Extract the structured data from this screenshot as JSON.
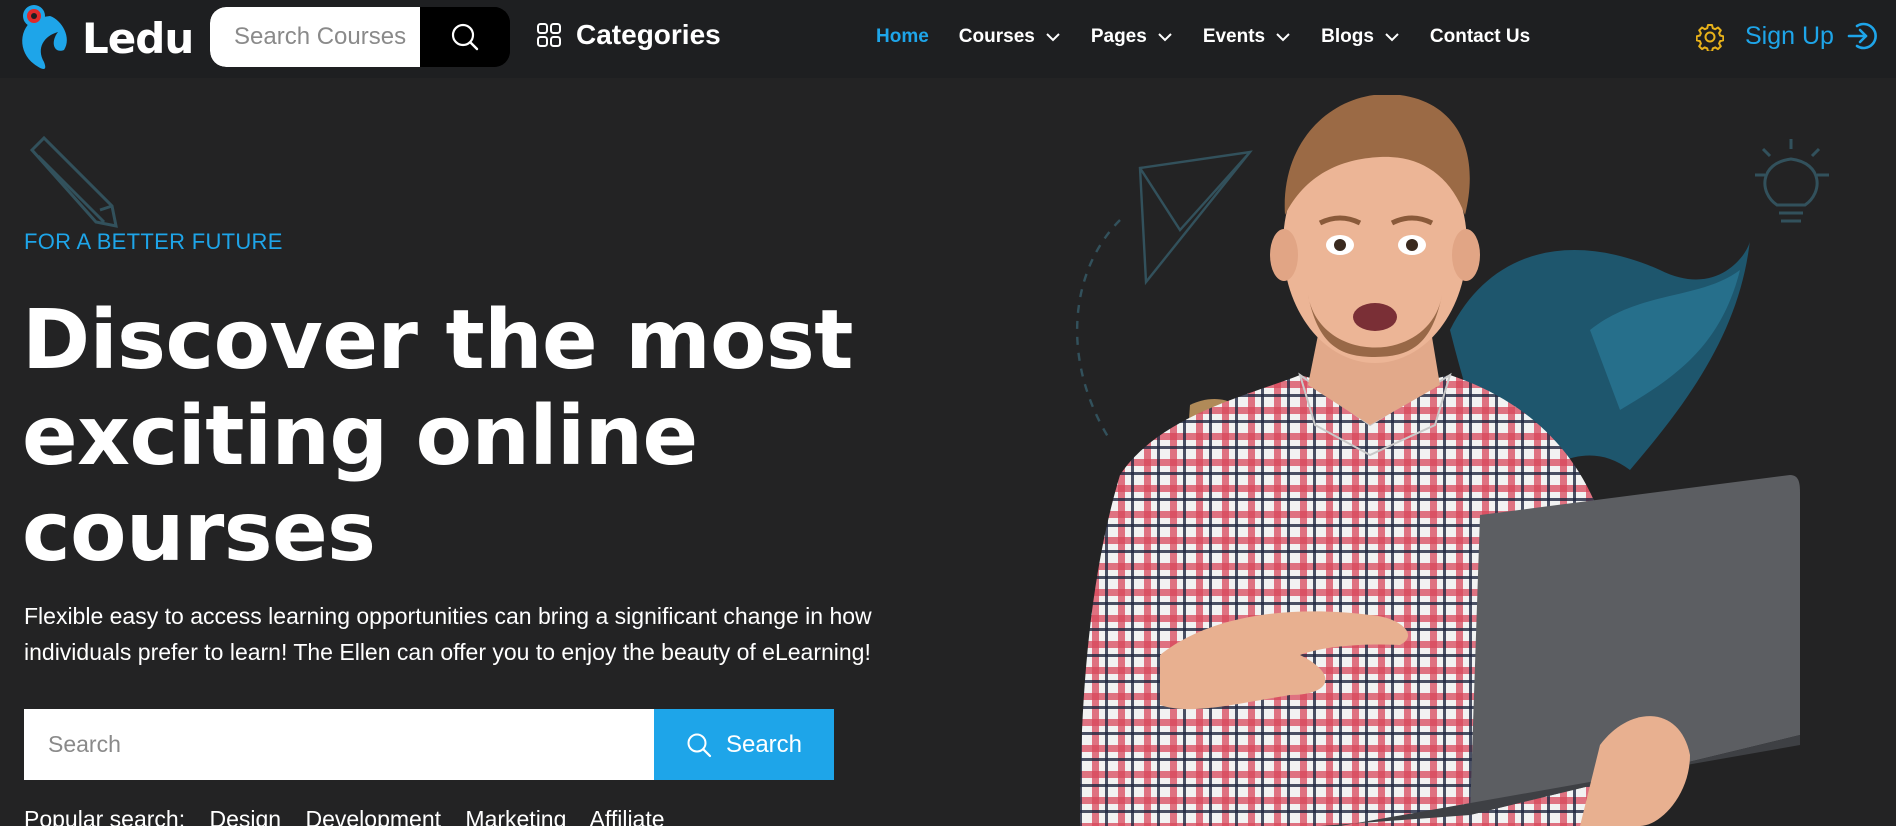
{
  "brand": {
    "name": "Ledu",
    "accent": "#1ea5e9"
  },
  "header": {
    "search_placeholder": "Search Courses",
    "categories_label": "Categories",
    "nav": [
      {
        "label": "Home",
        "active": true,
        "dropdown": false
      },
      {
        "label": "Courses",
        "active": false,
        "dropdown": true
      },
      {
        "label": "Pages",
        "active": false,
        "dropdown": true
      },
      {
        "label": "Events",
        "active": false,
        "dropdown": true
      },
      {
        "label": "Blogs",
        "active": false,
        "dropdown": true
      },
      {
        "label": "Contact Us",
        "active": false,
        "dropdown": false
      }
    ],
    "signup_label": "Sign Up",
    "icons": [
      "search-icon",
      "grid-icon",
      "chevron-down-icon",
      "gear-icon",
      "sign-in-icon"
    ]
  },
  "hero": {
    "eyebrow": "FOR A BETTER FUTURE",
    "headline": "Discover the most exciting online courses",
    "subtext": "Flexible easy to access learning opportunities can bring a significant change in how individuals prefer to learn! The Ellen can offer you to enjoy the beauty of eLearning!",
    "search_placeholder": "Search",
    "search_button": "Search",
    "popular_label": "Popular search:",
    "popular_tags": [
      "Design",
      "Development",
      "Marketing",
      "Affiliate"
    ]
  }
}
